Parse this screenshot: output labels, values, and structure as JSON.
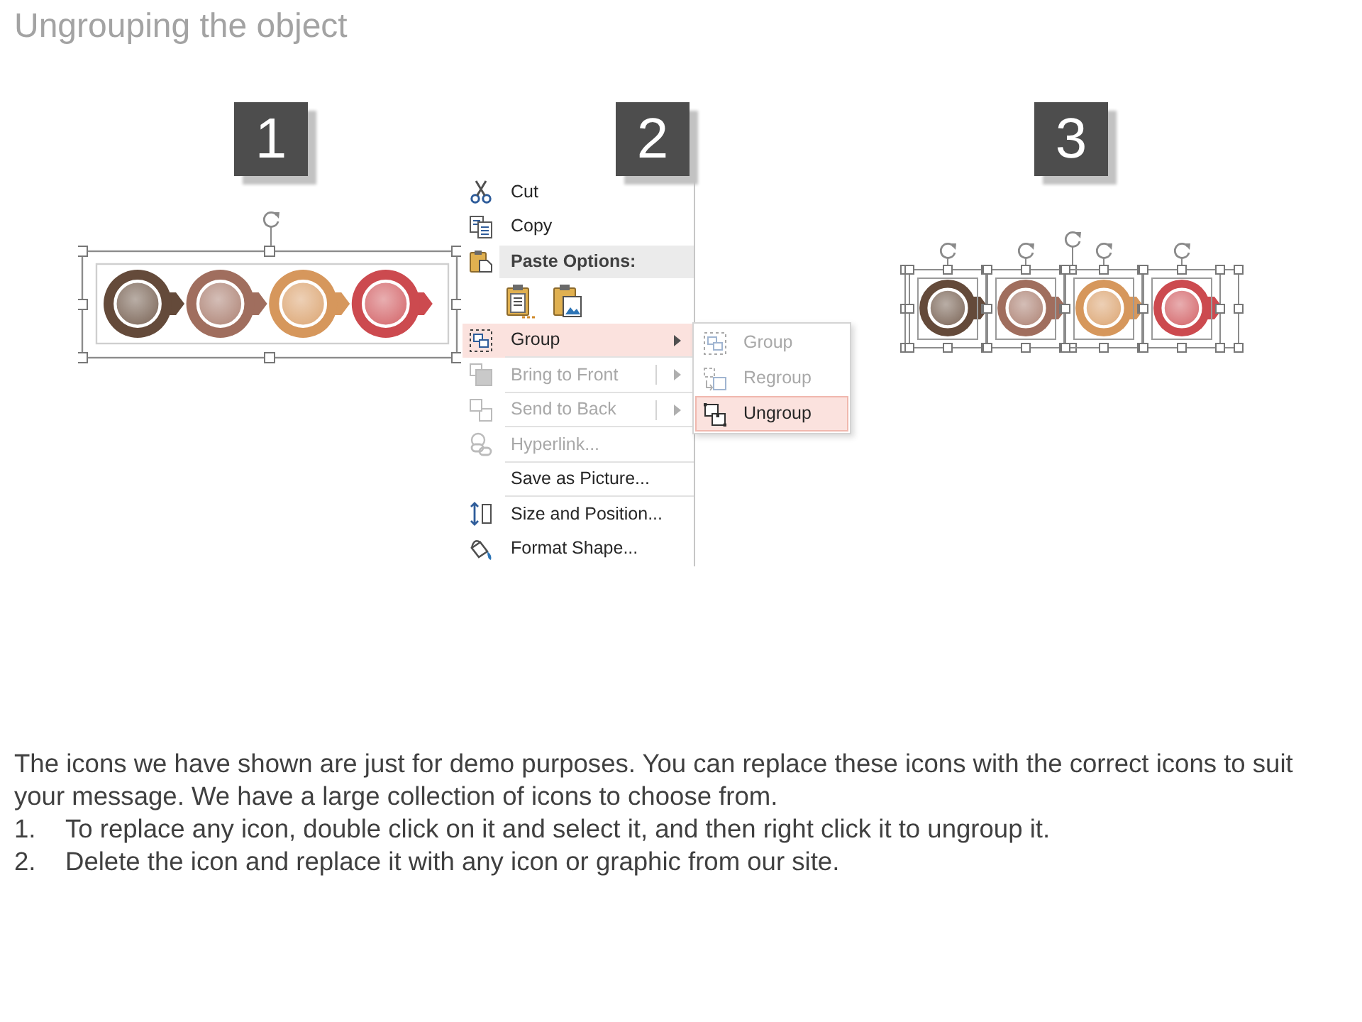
{
  "title": "Ungrouping the object",
  "steps": [
    {
      "number": "1",
      "kind": "grouped",
      "circles": [
        {
          "color": "#644a3a"
        },
        {
          "color": "#a06e5e"
        },
        {
          "color": "#d6975c"
        },
        {
          "color": "#cc4a4f"
        }
      ]
    },
    {
      "number": "2",
      "kind": "menu",
      "menu": {
        "items": [
          {
            "kind": "command",
            "label": "Cut",
            "selected": false,
            "disabled": false,
            "divider": false
          },
          {
            "kind": "command",
            "label": "Copy",
            "selected": false,
            "disabled": false,
            "divider": false
          },
          {
            "kind": "header",
            "label": "Paste Options:"
          },
          {
            "kind": "paste_icons"
          },
          {
            "kind": "submenu",
            "label": "Group",
            "selected": true,
            "disabled": false,
            "divider": true
          },
          {
            "kind": "split",
            "label": "Bring to Front",
            "selected": false,
            "disabled": true,
            "divider": true
          },
          {
            "kind": "split",
            "label": "Send to Back",
            "selected": false,
            "disabled": true,
            "divider": true
          },
          {
            "kind": "command",
            "label": "Hyperlink...",
            "selected": false,
            "disabled": true,
            "divider": true
          },
          {
            "kind": "command",
            "label": "Save as Picture...",
            "selected": false,
            "disabled": false,
            "divider": true
          },
          {
            "kind": "command",
            "label": "Size and Position...",
            "selected": false,
            "disabled": false,
            "divider": false
          },
          {
            "kind": "command",
            "label": "Format Shape...",
            "selected": false,
            "disabled": false,
            "divider": false
          }
        ],
        "submenu": {
          "items": [
            {
              "label": "Group",
              "selected": false,
              "disabled": true
            },
            {
              "label": "Regroup",
              "selected": false,
              "disabled": true
            },
            {
              "label": "Ungroup",
              "selected": true,
              "disabled": false
            }
          ]
        }
      }
    },
    {
      "number": "3",
      "kind": "ungrouped",
      "circles": [
        {
          "color": "#644a3a"
        },
        {
          "color": "#a06e5e"
        },
        {
          "color": "#d6975c"
        },
        {
          "color": "#cc4a4f"
        }
      ]
    }
  ],
  "description": {
    "paragraph": "The icons we have shown are just for demo purposes. You can replace these icons with the correct icons to suit your message. We have a large collection of icons to choose from.",
    "items": [
      {
        "number": "1.",
        "text": "To replace any icon, double click on it and select it, and then right click it to ungroup it."
      },
      {
        "number": "2.",
        "text": "Delete the icon and replace it with any icon or graphic from our site."
      }
    ]
  }
}
